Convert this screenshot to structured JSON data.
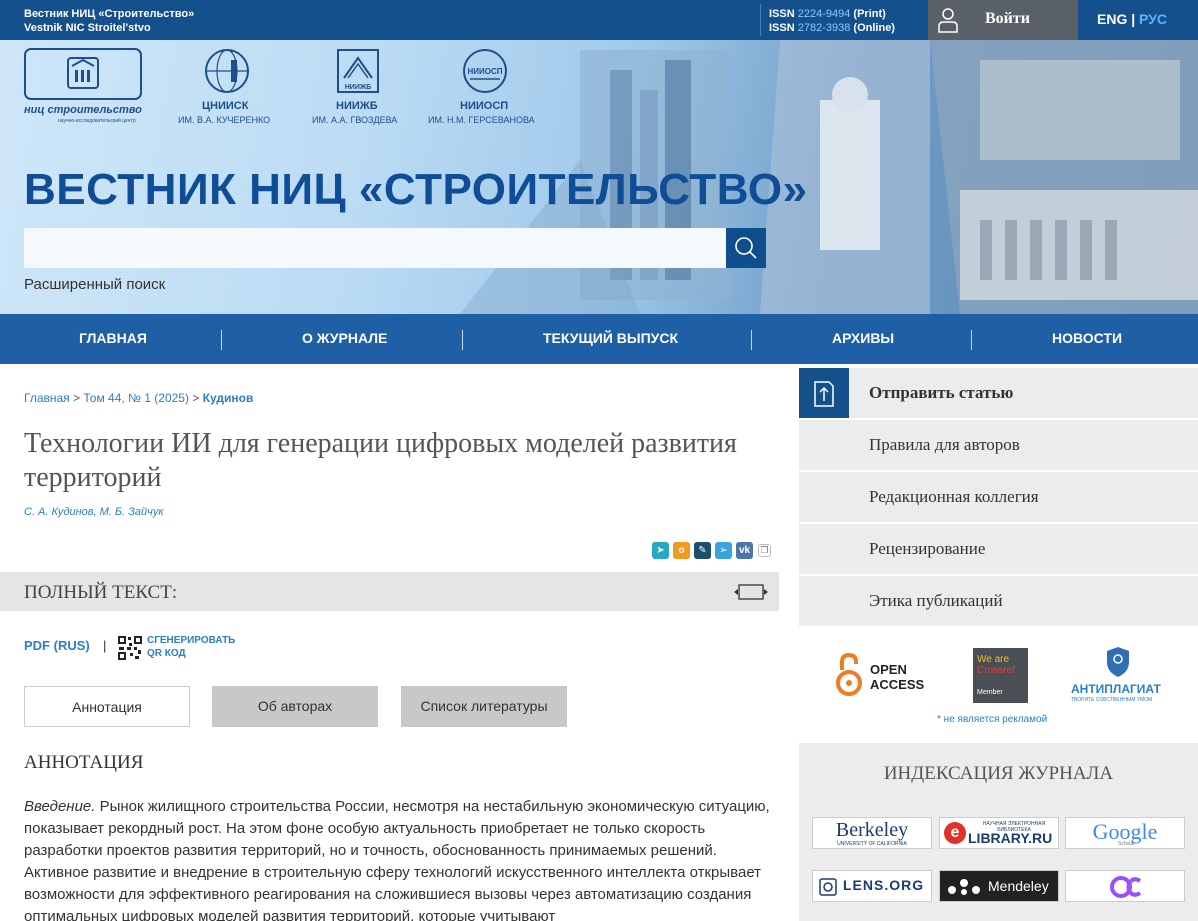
{
  "topbar": {
    "journal_ru": "Вестник НИЦ «Строительство»",
    "journal_en": "Vestnik NIC Stroitel'stvo",
    "issn_label": "ISSN",
    "issn_print": "2224-9494",
    "print_label": "(Print)",
    "issn_online": "2782-3938",
    "online_label": "(Online)",
    "login_label": "Войти",
    "lang_en": "ENG",
    "lang_sep": "|",
    "lang_ru": "РУС"
  },
  "hero": {
    "logos": [
      {
        "name": "ниц строительство",
        "sub": "научно-исследовательский центр"
      },
      {
        "name": "ЦНИИСК",
        "sub": "ИМ. В.А. КУЧЕРЕНКО"
      },
      {
        "name": "НИИЖБ",
        "sub": "ИМ. А.А. ГВОЗДЕВА"
      },
      {
        "name": "НИИОСП",
        "sub": "ИМ. Н.М. ГЕРСЕВАНОВА"
      }
    ],
    "logo_marks": {
      "niizhb": "НИИЖБ",
      "niiosp": "НИИОСП"
    },
    "title": "ВЕСТНИК НИЦ «СТРОИТЕЛЬСТВО»",
    "search_value": "",
    "advanced_search": "Расширенный поиск"
  },
  "nav": [
    "ГЛАВНАЯ",
    "О ЖУРНАЛЕ",
    "ТЕКУЩИЙ ВЫПУСК",
    "АРХИВЫ",
    "НОВОСТИ"
  ],
  "breadcrumb": {
    "home": "Главная",
    "sep": ">",
    "issue": "Том 44, № 1 (2025)",
    "current": "Кудинов"
  },
  "article": {
    "title": "Технологии ИИ для генерации цифровых моделей развития территорий",
    "authors": "С. А. Кудинов, М. Б. Зайчук",
    "share_icons": [
      "share-icon",
      "odnoklassniki-icon",
      "livejournal-icon",
      "telegram-icon",
      "vk-icon",
      "copy-icon"
    ]
  },
  "fulltext": {
    "label": "ПОЛНЫЙ ТЕКСТ:",
    "pdf": "PDF (RUS)",
    "pipe": "|",
    "qr_line1": "СГЕНЕРИРОВАТЬ",
    "qr_line2": "QR КОД"
  },
  "tabs": [
    "Аннотация",
    "Об авторах",
    "Список литературы"
  ],
  "annotation": {
    "heading": "АННОТАЦИЯ",
    "intro_label": "Введение.",
    "text": "Рынок жилищного строительства России, несмотря на нестабильную экономическую ситуацию, показывает рекордный рост. На этом фоне особую актуальность приобретает не только скорость разработки проектов развития территорий, но и точность, обоснованность принимаемых решений. Активное развитие и внедрение в строительную сферу технологий искусственного интеллекта открывает возможности для эффективного реагирования на сложившиеся вызовы через автоматизацию создания оптимальных цифровых моделей развития территорий, которые учитывают"
  },
  "sidebar": {
    "menu": [
      "Отправить статью",
      "Правила для авторов",
      "Редакционная коллегия",
      "Рецензирование",
      "Этика публикаций"
    ],
    "badges": {
      "open_access_1": "OPEN",
      "open_access_2": "ACCESS",
      "crossref_1": "We are",
      "crossref_2": "Crossref",
      "crossref_3": "Member",
      "antiplagiat": "АНТИПЛАГИАТ",
      "antiplagiat_sub": "ТВОРИТЕ СОБСТВЕННЫМ УМОМ"
    },
    "ad_note": "* не является рекламой",
    "index_heading": "ИНДЕКСАЦИЯ ЖУРНАЛА",
    "index": {
      "berkeley": "Berkeley",
      "berkeley_sub": "UNIVERSITY OF CALIFORNIA",
      "elibrary_top": "НАУЧНАЯ ЭЛЕКТРОННАЯ БИБЛИОТЕКА",
      "elibrary": "LIBRARY.RU",
      "google": "Google",
      "google_sub": "Scholar",
      "lens": "LENS.ORG",
      "mendeley": "Mendeley"
    }
  },
  "colors": {
    "brand_dark": "#14508c",
    "nav_blue": "#1f5fa6",
    "link_blue": "#2a7fc7",
    "title_blue": "#0f4e96"
  }
}
